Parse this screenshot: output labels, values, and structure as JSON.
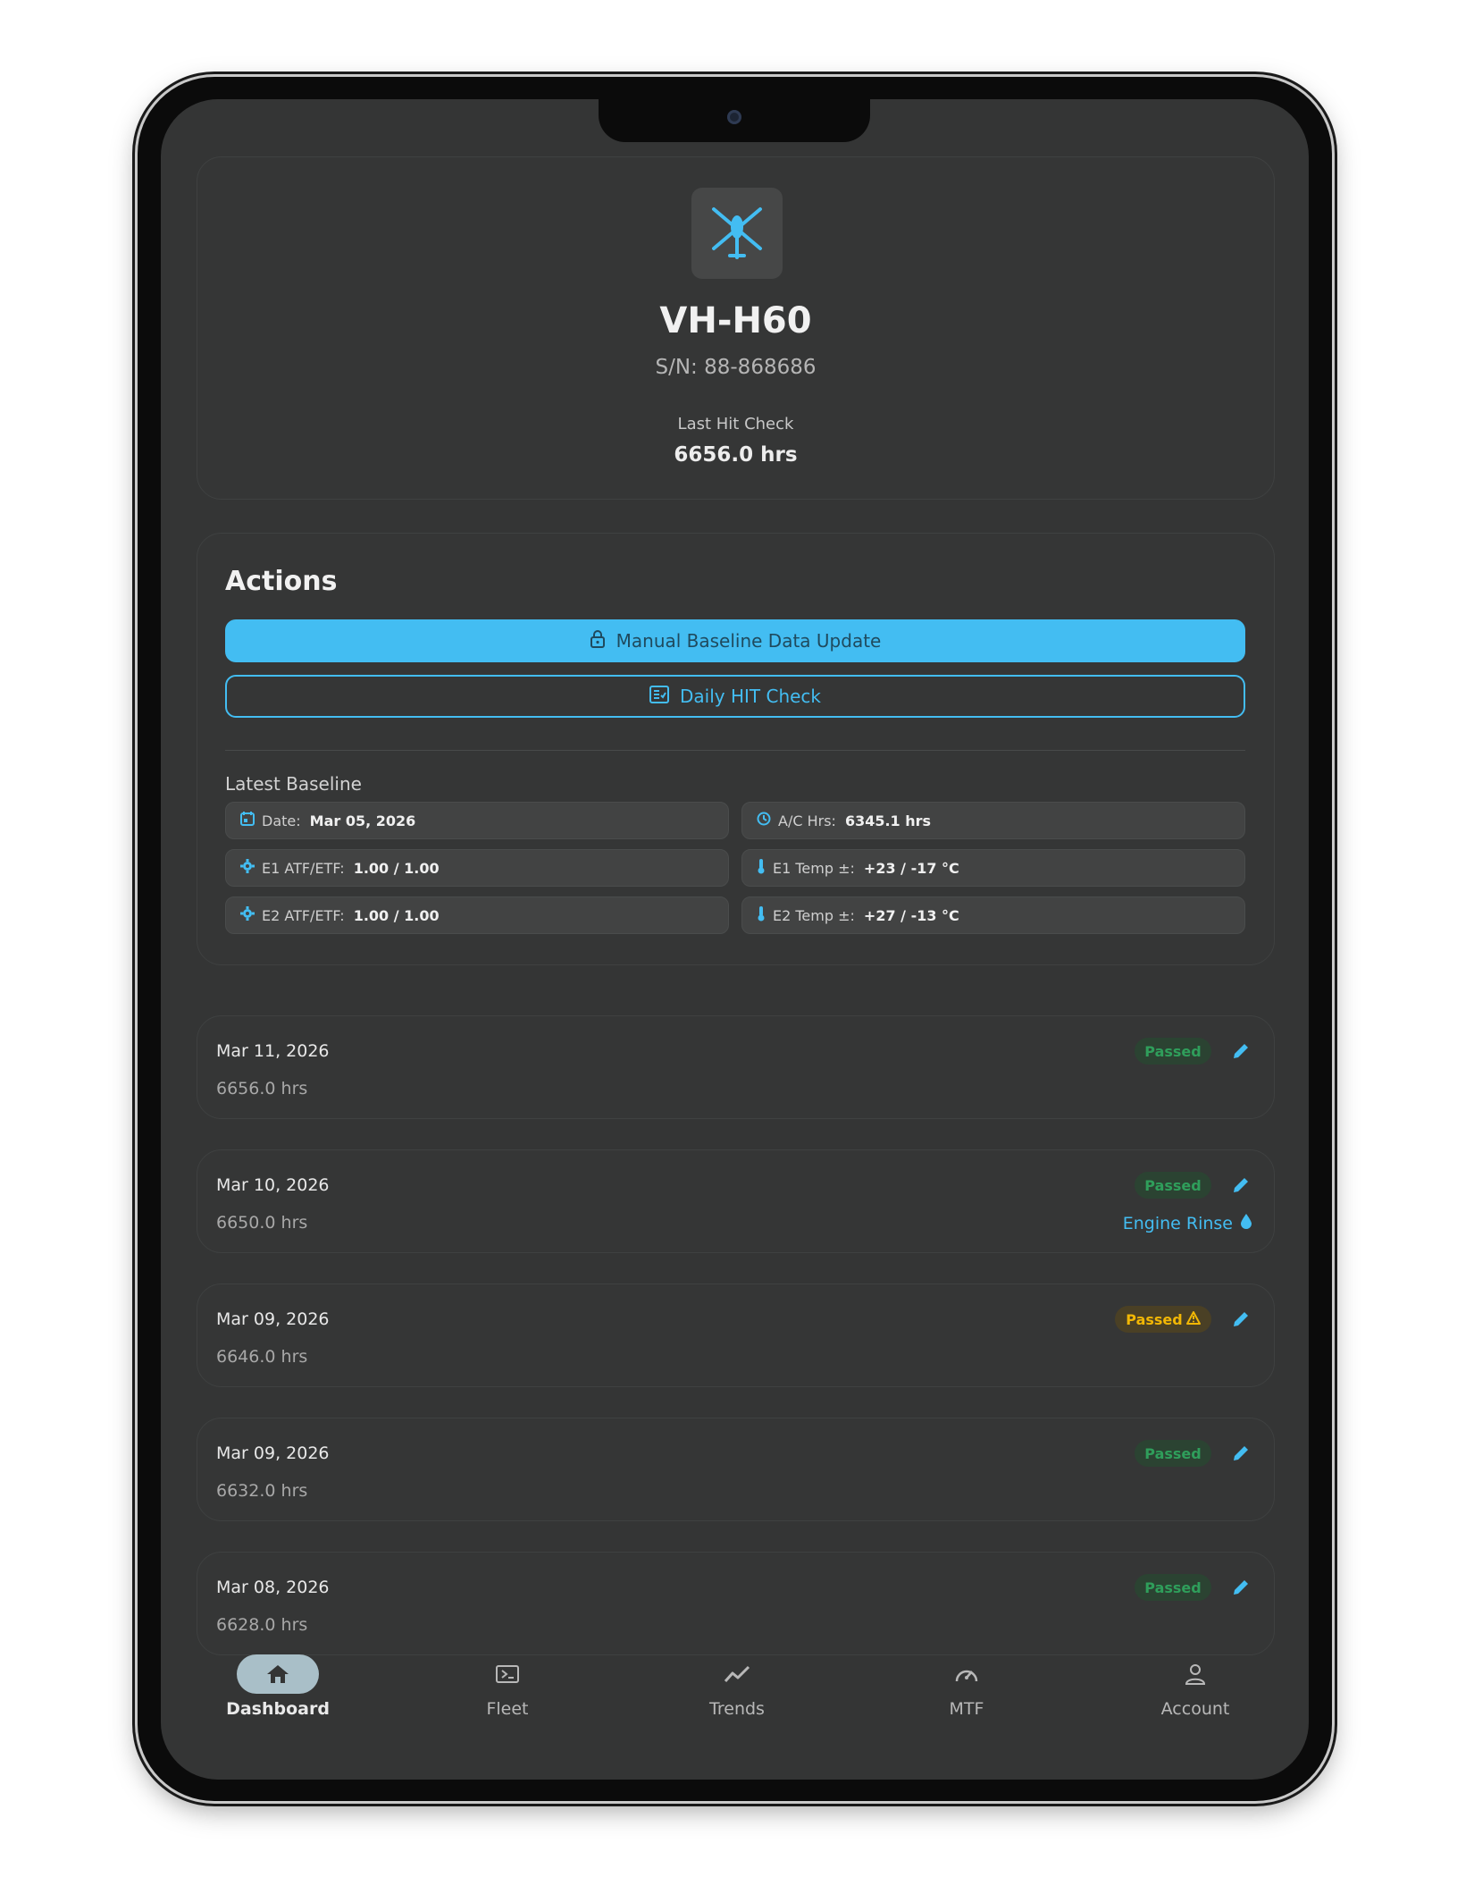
{
  "aircraft": {
    "registration": "VH-H60",
    "serial": "S/N: 88-868686",
    "last_check_label": "Last Hit Check",
    "last_check_hours": "6656.0 hrs",
    "icon": "helicopter-icon"
  },
  "actions": {
    "title": "Actions",
    "manual_update_label": "Manual Baseline Data Update",
    "daily_check_label": "Daily HIT Check"
  },
  "baseline": {
    "title": "Latest Baseline",
    "date_label": "Date:",
    "date_value": "Mar 05, 2026",
    "ac_hrs_label": "A/C Hrs:",
    "ac_hrs_value": "6345.1 hrs",
    "e1_atf_label": "E1 ATF/ETF:",
    "e1_atf_value": "1.00 / 1.00",
    "e1_temp_label": "E1 Temp ±:",
    "e1_temp_value": "+23 / -17 °C",
    "e2_atf_label": "E2 ATF/ETF:",
    "e2_atf_value": "1.00 / 1.00",
    "e2_temp_label": "E2 Temp ±:",
    "e2_temp_value": "+27 / -13 °C"
  },
  "checks": [
    {
      "date": "Mar 11, 2026",
      "hours": "6656.0 hrs",
      "status": "Passed"
    },
    {
      "date": "Mar 10, 2026",
      "hours": "6650.0 hrs",
      "status": "Passed",
      "note": "Engine Rinse"
    },
    {
      "date": "Mar 09, 2026",
      "hours": "6646.0 hrs",
      "status": "Passed"
    },
    {
      "date": "Mar 09, 2026",
      "hours": "6632.0 hrs",
      "status": "Passed"
    },
    {
      "date": "Mar 08, 2026",
      "hours": "6628.0 hrs",
      "status": "Passed"
    }
  ],
  "nav": {
    "dashboard": "Dashboard",
    "fleet": "Fleet",
    "trends": "Trends",
    "mtf": "MTF",
    "account": "Account"
  },
  "colors": {
    "accent": "#43bdf2",
    "passed": "#2f9e5b",
    "warning": "#f2b705",
    "background": "#343535"
  }
}
